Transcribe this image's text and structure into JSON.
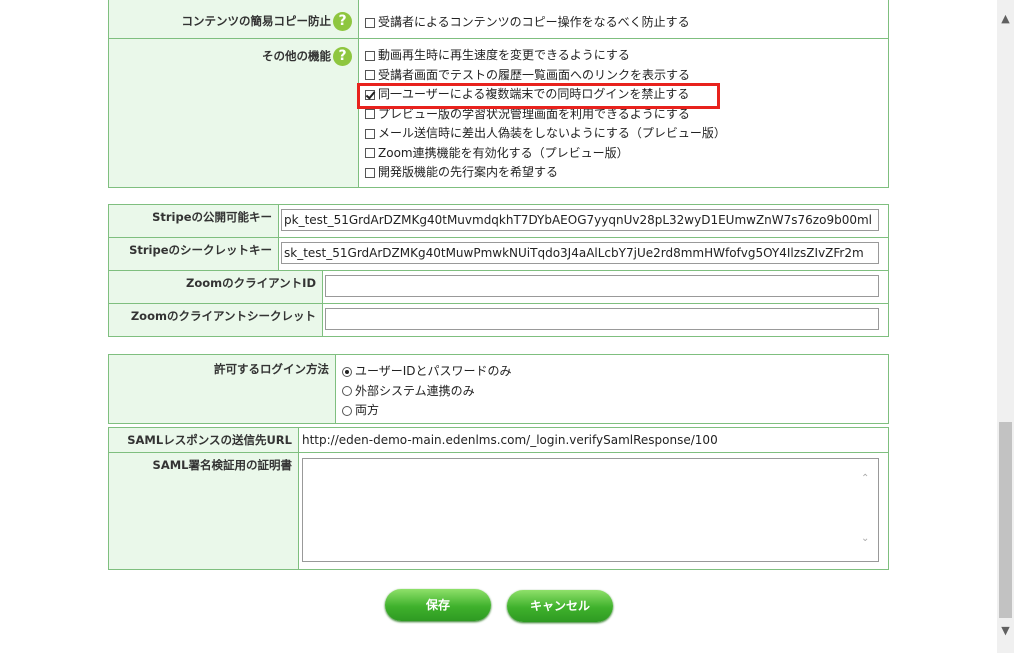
{
  "settings": {
    "copy_protect": {
      "label": "コンテンツの簡易コピー防止",
      "option": "受講者によるコンテンツのコピー操作をなるべく防止する"
    },
    "other_features": {
      "label": "その他の機能",
      "options": [
        {
          "label": "動画再生時に再生速度を変更できるようにする",
          "checked": false
        },
        {
          "label": "受講者画面でテストの履歴一覧画面へのリンクを表示する",
          "checked": false
        },
        {
          "label": "同一ユーザーによる複数端末での同時ログインを禁止する",
          "checked": true
        },
        {
          "label": "プレビュー版の学習状況管理画面を利用できるようにする",
          "checked": false
        },
        {
          "label": "メール送信時に差出人偽装をしないようにする（プレビュー版）",
          "checked": false
        },
        {
          "label": "Zoom連携機能を有効化する（プレビュー版）",
          "checked": false
        },
        {
          "label": "開発版機能の先行案内を希望する",
          "checked": false
        }
      ]
    },
    "help_icon_glyph": "?"
  },
  "keys": {
    "stripe_public_label": "Stripeの公開可能キー",
    "stripe_public_value": "pk_test_51GrdArDZMKg40tMuvmdqkhT7DYbAEOG7yyqnUv28pL32wyD1EUmwZnW7s76zo9b00ml",
    "stripe_secret_label": "Stripeのシークレットキー",
    "stripe_secret_value": "sk_test_51GrdArDZMKg40tMuwPmwkNUiTqdo3J4aAlLcbY7jUe2rd8mmHWfofvg5OY4IlzsZIvZFr2m",
    "zoom_client_id_label": "ZoomのクライアントID",
    "zoom_client_id_value": "",
    "zoom_client_secret_label": "Zoomのクライアントシークレット",
    "zoom_client_secret_value": ""
  },
  "login": {
    "label": "許可するログイン方法",
    "options": [
      {
        "label": "ユーザーIDとパスワードのみ",
        "selected": true
      },
      {
        "label": "外部システム連携のみ",
        "selected": false
      },
      {
        "label": "両方",
        "selected": false
      }
    ],
    "saml_url_label": "SAMLレスポンスの送信先URL",
    "saml_url_value": "http://eden-demo-main.edenlms.com/_login.verifySamlResponse/100",
    "saml_cert_label": "SAML署名検証用の証明書",
    "saml_cert_value": ""
  },
  "buttons": {
    "save": "保存",
    "cancel": "キャンセル"
  },
  "colors": {
    "label_bg": "#eaf8ea",
    "border": "#7fbf7f",
    "button_green": "#3fb12c",
    "highlight_red": "#e8221d",
    "help_green": "#8ec63f"
  }
}
